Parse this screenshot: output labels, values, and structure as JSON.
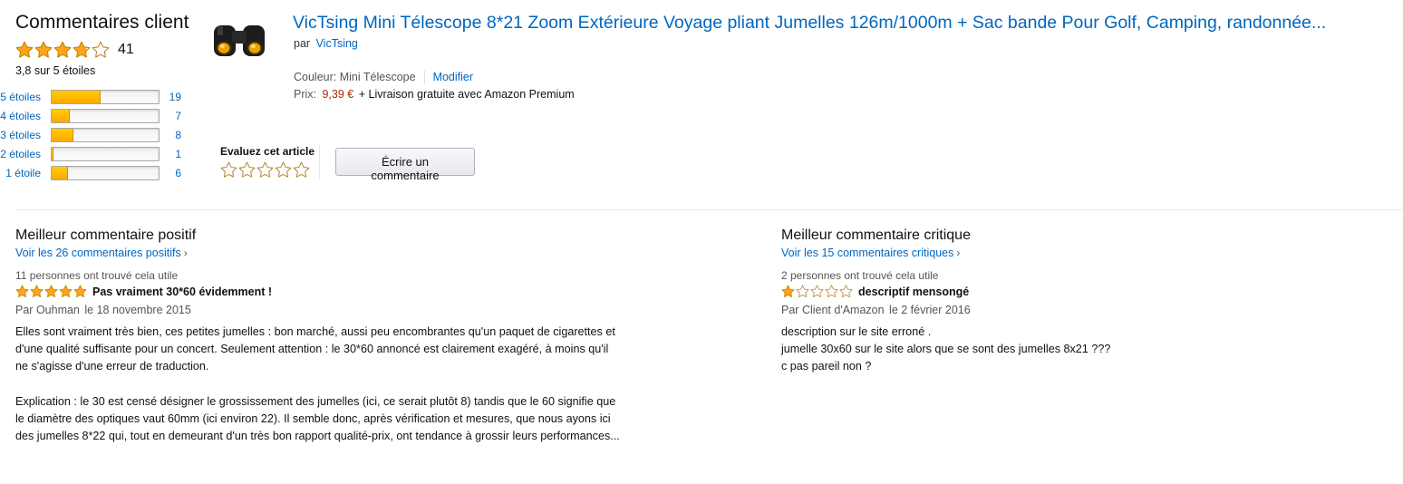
{
  "summary": {
    "heading": "Commentaires client",
    "rating": 3.8,
    "review_count": "41",
    "rating_text": "3,8 sur 5 étoiles",
    "histogram": [
      {
        "label": "5 étoiles",
        "count": "19",
        "fraction": 0.46
      },
      {
        "label": "4 étoiles",
        "count": "7",
        "fraction": 0.17
      },
      {
        "label": "3 étoiles",
        "count": "8",
        "fraction": 0.2
      },
      {
        "label": "2 étoiles",
        "count": "1",
        "fraction": 0.02
      },
      {
        "label": "1 étoile",
        "count": "6",
        "fraction": 0.15
      }
    ]
  },
  "product": {
    "title": "VicTsing Mini Télescope 8*21 Zoom Extérieure Voyage pliant Jumelles 126m/1000m + Sac bande Pour Golf, Camping, randonnée...",
    "by_prefix": "par",
    "brand": "VicTsing",
    "color_label": "Couleur: Mini Télescope",
    "modify_link": "Modifier",
    "price_label": "Prix:",
    "price": "9,39 €",
    "shipping": "+ Livraison gratuite avec Amazon Premium",
    "image_icon": "binoculars-icon"
  },
  "rate": {
    "label": "Evaluez cet article",
    "write_button": "Écrire un commentaire"
  },
  "positive": {
    "heading": "Meilleur commentaire positif",
    "see_all": "Voir les 26 commentaires positifs",
    "helpful": "11 personnes ont trouvé cela utile",
    "stars": 5,
    "title": "Pas vraiment 30*60 évidemment !",
    "by": "Par",
    "author": "Ouhman",
    "date": "le 18 novembre 2015",
    "body": [
      "Elles sont vraiment très bien, ces petites jumelles : bon marché, aussi peu encombrantes qu'un paquet de cigarettes et",
      "d'une qualité suffisante pour un concert. Seulement attention : le 30*60 annoncé est clairement exagéré, à moins qu'il",
      "ne s'agisse d'une erreur de traduction.",
      "",
      "Explication : le 30 est censé désigner le grossissement des jumelles (ici, ce serait plutôt 8) tandis que le 60 signifie que",
      "le diamètre des optiques vaut 60mm (ici environ 22). Il semble donc, après vérification et mesures, que nous ayons ici",
      "des jumelles 8*22 qui, tout en demeurant d'un très bon rapport qualité-prix, ont tendance à grossir leurs performances..."
    ]
  },
  "critical": {
    "heading": "Meilleur commentaire critique",
    "see_all": "Voir les 15 commentaires critiques",
    "helpful": "2 personnes ont trouvé cela utile",
    "stars": 1,
    "title": "descriptif mensongé",
    "by": "Par",
    "author": "Client d'Amazon",
    "date": "le 2 février 2016",
    "body": [
      "description sur le site erroné .",
      "jumelle 30x60 sur le site alors que se sont des jumelles 8x21 ???",
      "c pas pareil non ?"
    ]
  },
  "colors": {
    "link": "#0066c0",
    "price": "#b12704",
    "star": "#ffa41c"
  }
}
